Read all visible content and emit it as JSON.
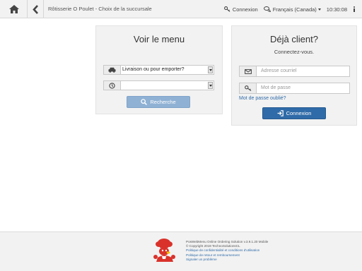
{
  "header": {
    "title": "Rôtisserie O Poulet - Choix de la succursale",
    "login_label": "Connexion",
    "language_label": "Français (Canada)",
    "time": "10:30:08"
  },
  "menu_panel": {
    "title": "Voir le menu",
    "order_type_value": "Livraison ou pour emporter?",
    "time_value": "",
    "search_label": "Recherche"
  },
  "client_panel": {
    "title": "Déjà client?",
    "subtitle": "Connectez-vous.",
    "email_placeholder": "Adresse courriel",
    "password_placeholder": "Mot de passe",
    "forgot_password": "Mot de passe oublié?",
    "login_button": "Connexion"
  },
  "footer": {
    "version": "PosWebMenu Online Ordering Solution v.3.9.1.20 Mobile",
    "copyright": "© Copyright 2019 TechnoSolutionsCL",
    "privacy_link": "Politique de confidentialité et conditions d'utilisation",
    "refund_link": "Politique de retour et remboursement",
    "report_link": "Signaler un problème"
  },
  "colors": {
    "accent": "#2f6ba8",
    "search_button": "#8fb1d4",
    "panel_bg": "#f2f2f2",
    "logo_red": "#d9322b"
  },
  "icons": {
    "home": "home-icon",
    "back": "chevron-left-icon",
    "login": "key-icon",
    "language": "comments-icon",
    "info": "info-icon",
    "car": "car-icon",
    "clock": "clock-icon",
    "search": "search-icon",
    "email": "envelope-icon",
    "password": "key-icon",
    "signin": "sign-in-icon"
  }
}
